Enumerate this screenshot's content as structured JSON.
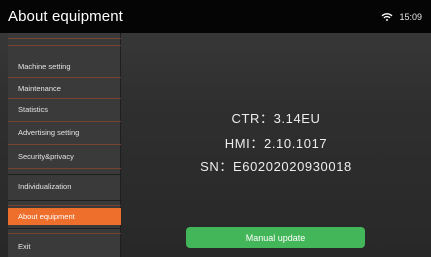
{
  "header": {
    "title": "About equipment",
    "time": "15:09",
    "wifi_icon": "wifi-icon"
  },
  "sidebar": {
    "items": [
      {
        "label": "Machine setting"
      },
      {
        "label": "Maintenance"
      },
      {
        "label": "Statistics"
      },
      {
        "label": "Advertising setting"
      },
      {
        "label": "Security&privacy"
      },
      {
        "label": "Individualization"
      },
      {
        "label": "About equipment",
        "active": true
      },
      {
        "label": "Exit"
      }
    ]
  },
  "info": {
    "ctr": "CTR：3.14EU",
    "hmi": "HMI：2.10.1017",
    "sn": "SN：E60202020930018"
  },
  "actions": {
    "manual_update": "Manual update"
  },
  "colors": {
    "accent": "#ee6e2c",
    "button": "#43b65a",
    "topbar": "#050505"
  }
}
